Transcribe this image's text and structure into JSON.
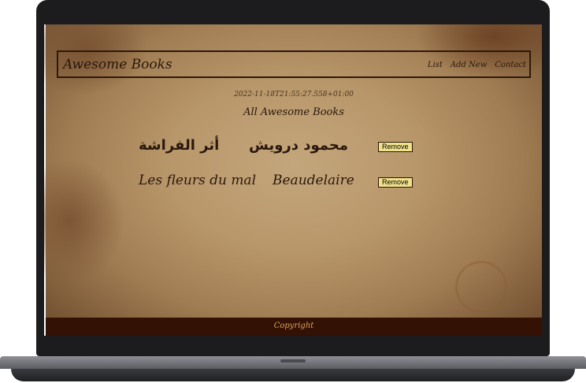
{
  "navbar": {
    "brand": "Awesome Books",
    "links": [
      "List",
      "Add New",
      "Contact"
    ]
  },
  "datetime": "2022-11-18T21:55:27.558+01:00",
  "section_title": "All Awesome Books",
  "books": [
    {
      "title": "أثر الفراشة",
      "author": "محمود درويش",
      "remove_label": "Remove"
    },
    {
      "title": "Les fleurs du mal",
      "author": "Beaudelaire",
      "remove_label": "Remove"
    }
  ],
  "footer": {
    "copyright": "Copyright"
  }
}
